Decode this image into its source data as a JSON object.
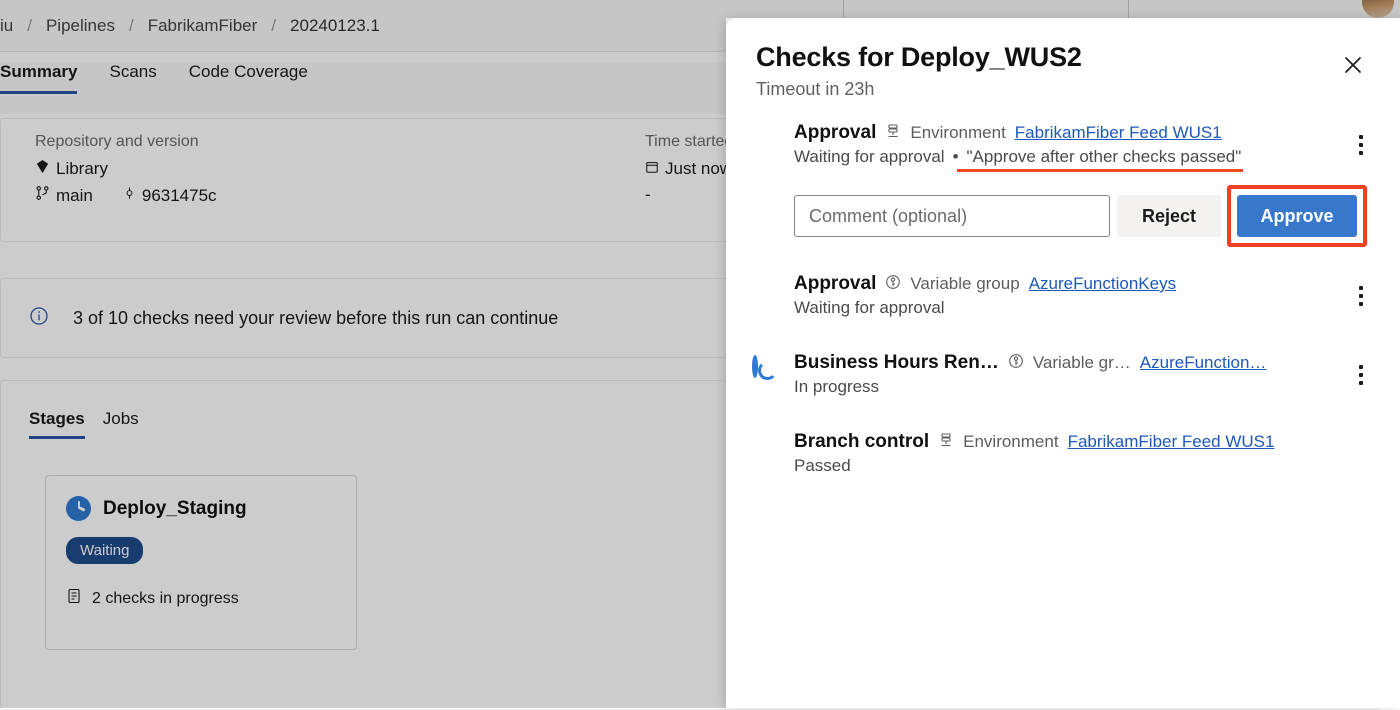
{
  "background": {
    "breadcrumb": {
      "items": [
        "iu",
        "Pipelines",
        "FabrikamFiber",
        "20240123.1"
      ],
      "separator": "/"
    },
    "tabs": [
      {
        "label": "Summary",
        "active": true
      },
      {
        "label": "Scans",
        "active": false
      },
      {
        "label": "Code Coverage",
        "active": false
      }
    ],
    "summary": {
      "repo_label": "Repository and version",
      "repo_name": "Library",
      "branch": "main",
      "commit": "9631475c",
      "time_label": "Time started",
      "time_value": "Just now",
      "elapsed_value": "-"
    },
    "info_banner": {
      "text": "3 of 10 checks need your review before this run can continue",
      "icon": "info-circle-icon"
    },
    "stages_section": {
      "tabs": [
        {
          "label": "Stages",
          "active": true
        },
        {
          "label": "Jobs",
          "active": false
        }
      ],
      "stage_card": {
        "name": "Deploy_Staging",
        "status_icon": "clock-icon",
        "badge": "Waiting",
        "checks_text": "2 checks in progress",
        "checks_icon": "checklist-icon"
      }
    }
  },
  "panel": {
    "title": "Checks for Deploy_WUS2",
    "subtitle": "Timeout in 23h",
    "close_icon": "close-icon",
    "checks": [
      {
        "name": "Approval",
        "resource_icon": "environment-icon",
        "resource_type": "Environment",
        "resource_link": "FabrikamFiber Feed WUS1",
        "status": "Waiting for approval",
        "separator": "•",
        "instruction": "\"Approve after other checks passed\"",
        "status_icon": "clock-icon",
        "menu_icon": "kebab-menu-icon",
        "has_actions": true
      },
      {
        "name": "Approval",
        "resource_icon": "variable-group-icon",
        "resource_type": "Variable group",
        "resource_link": "AzureFunctionKeys",
        "status": "Waiting for approval",
        "status_icon": "clock-icon",
        "menu_icon": "kebab-menu-icon",
        "has_actions": false
      },
      {
        "name": "Business Hours Ren…",
        "resource_icon": "variable-group-icon",
        "resource_type": "Variable gr…",
        "resource_link": "AzureFunction…",
        "status": "In progress",
        "status_icon": "in-progress-icon",
        "menu_icon": "kebab-menu-icon",
        "has_actions": false
      },
      {
        "name": "Branch control",
        "resource_icon": "environment-icon",
        "resource_type": "Environment",
        "resource_link": "FabrikamFiber Feed WUS1",
        "status": "Passed",
        "status_icon": "passed-icon",
        "menu_icon": null,
        "has_actions": false
      }
    ],
    "actions": {
      "comment_placeholder": "Comment (optional)",
      "comment_value": "",
      "reject_label": "Reject",
      "approve_label": "Approve"
    }
  },
  "colors": {
    "accent_blue": "#3878ca",
    "link_blue": "#1d58ba",
    "highlight_red": "#ef4123",
    "tab_underline": "#2a55a8",
    "waiting_badge": "#1f4c8a",
    "passed_green": "#5aa566"
  }
}
